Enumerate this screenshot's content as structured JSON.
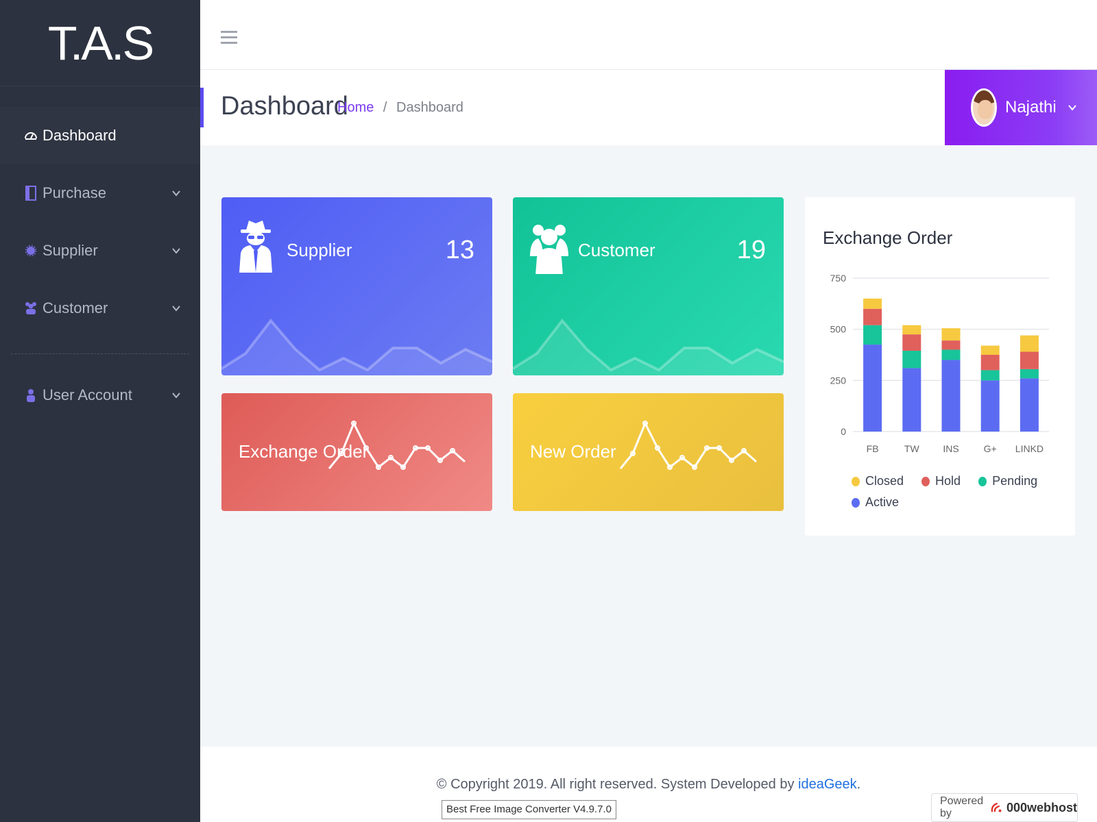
{
  "brand": {
    "title": "T.A.S"
  },
  "sidebar": {
    "items": [
      {
        "label": "Dashboard",
        "icon": "dashboard-icon",
        "active": true
      },
      {
        "label": "Purchase",
        "icon": "purchase-icon"
      },
      {
        "label": "Supplier",
        "icon": "supplier-icon"
      },
      {
        "label": "Customer",
        "icon": "customer-icon"
      },
      {
        "label": "User Account",
        "icon": "user-icon"
      }
    ]
  },
  "header": {
    "page_title": "Dashboard",
    "breadcrumb": {
      "home": "Home",
      "sep": "/",
      "current": "Dashboard"
    },
    "user": {
      "name": "Najathi"
    }
  },
  "cards": {
    "supplier": {
      "title": "Supplier",
      "count": "13",
      "color": "#4f5df5"
    },
    "customer": {
      "title": "Customer",
      "count": "19",
      "color": "#12c297"
    },
    "exchange": {
      "title": "Exchange Order",
      "color": "#de5b57"
    },
    "new_order": {
      "title": "New Order",
      "color": "#f9cf3f"
    }
  },
  "chart_panel": {
    "title": "Exchange Order"
  },
  "chart_data": {
    "type": "bar",
    "stacked": true,
    "categories": [
      "FB",
      "TW",
      "INS",
      "G+",
      "LINKD"
    ],
    "ylim": [
      0,
      750
    ],
    "yticks": [
      "0",
      "250",
      "500",
      "750"
    ],
    "series": [
      {
        "name": "Active",
        "color": "#5b6cf2",
        "values": [
          425,
          310,
          350,
          250,
          260
        ]
      },
      {
        "name": "Pending",
        "color": "#18c49a",
        "values": [
          95,
          85,
          50,
          50,
          45
        ]
      },
      {
        "name": "Hold",
        "color": "#e0605c",
        "values": [
          80,
          80,
          45,
          75,
          85
        ]
      },
      {
        "name": "Closed",
        "color": "#f6c940",
        "values": [
          50,
          45,
          60,
          45,
          80
        ]
      }
    ],
    "legend_order": [
      "Closed",
      "Hold",
      "Pending",
      "Active"
    ],
    "legend_position": "bottom",
    "grid": true
  },
  "footer": {
    "copyright": "© Copyright 2019. All right reserved. System Developed by ",
    "developer": "ideaGeek",
    "period": ".",
    "converter": "Best Free Image Converter V4.9.7.0",
    "powered_by": "Powered by",
    "host": "000webhost"
  }
}
